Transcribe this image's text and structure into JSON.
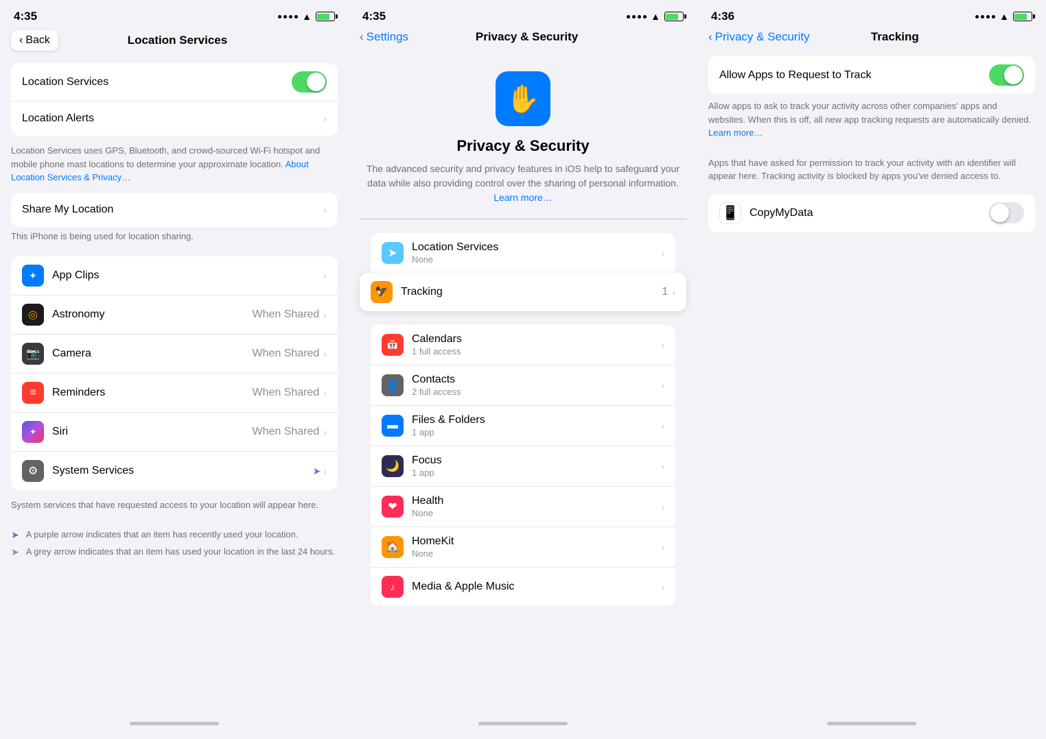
{
  "panel1": {
    "time": "4:35",
    "title": "Location Services",
    "back_label": "Back",
    "items": [
      {
        "id": "location-services",
        "label": "Location Services",
        "toggle": "on",
        "icon_color": "green",
        "icon": "📍"
      },
      {
        "id": "location-alerts",
        "label": "Location Alerts",
        "chevron": true,
        "icon_color": "none",
        "icon": ""
      }
    ],
    "info_text": "Location Services uses GPS, Bluetooth, and crowd-sourced Wi-Fi hotspot and mobile phone mast locations to determine your approximate location.",
    "info_link": "About Location Services & Privacy…",
    "share_my_location_label": "Share My Location",
    "share_my_location_subtitle": "This iPhone is being used for location sharing.",
    "app_list": [
      {
        "label": "App Clips",
        "icon": "🔵",
        "icon_color": "blue",
        "value": "",
        "chevron": true
      },
      {
        "label": "Astronomy",
        "icon": "⭕",
        "icon_color": "dark",
        "value": "When Shared",
        "chevron": true
      },
      {
        "label": "Camera",
        "icon": "📷",
        "icon_color": "gray",
        "value": "When Shared",
        "chevron": true
      },
      {
        "label": "Reminders",
        "icon": "📋",
        "icon_color": "red",
        "value": "When Shared",
        "chevron": true
      },
      {
        "label": "Siri",
        "icon": "🎨",
        "icon_color": "purple",
        "value": "When Shared",
        "chevron": true
      },
      {
        "label": "System Services",
        "icon": "⚙️",
        "icon_color": "gray",
        "value": "",
        "chevron": true,
        "arrow_purple": true
      }
    ],
    "legend_purple": "A purple arrow indicates that an item has recently used your location.",
    "legend_gray": "A grey arrow indicates that an item has used your location in the last 24 hours."
  },
  "panel2": {
    "time": "4:35",
    "back_label": "Settings",
    "title": "Privacy & Security",
    "hero_icon": "✋",
    "hero_title": "Privacy & Security",
    "hero_desc": "The advanced security and privacy features in iOS help to safeguard your data while also providing control over the sharing of personal information.",
    "hero_link": "Learn more…",
    "menu_items": [
      {
        "id": "location-services",
        "label": "Location Services",
        "subtitle": "None",
        "icon": "✈️",
        "icon_color": "teal",
        "chevron": true,
        "badge": ""
      },
      {
        "id": "tracking",
        "label": "Tracking",
        "subtitle": "",
        "icon": "🦅",
        "icon_color": "orange",
        "chevron": true,
        "badge": "1",
        "highlighted": true
      },
      {
        "id": "calendars",
        "label": "Calendars",
        "subtitle": "1 full access",
        "icon": "📅",
        "icon_color": "red",
        "chevron": true
      },
      {
        "id": "contacts",
        "label": "Contacts",
        "subtitle": "2 full access",
        "icon": "👥",
        "icon_color": "gray",
        "chevron": true
      },
      {
        "id": "files-folders",
        "label": "Files & Folders",
        "subtitle": "1 app",
        "icon": "📁",
        "icon_color": "blue",
        "chevron": true
      },
      {
        "id": "focus",
        "label": "Focus",
        "subtitle": "1 app",
        "icon": "🌙",
        "icon_color": "navy",
        "chevron": true
      },
      {
        "id": "health",
        "label": "Health",
        "subtitle": "None",
        "icon": "❤️",
        "icon_color": "pink",
        "chevron": true
      },
      {
        "id": "homekit",
        "label": "HomeKit",
        "subtitle": "None",
        "icon": "🏠",
        "icon_color": "orange",
        "chevron": true
      },
      {
        "id": "media-apple-music",
        "label": "Media & Apple Music",
        "subtitle": "",
        "icon": "🎵",
        "icon_color": "pink",
        "chevron": true
      }
    ]
  },
  "panel3": {
    "time": "4:36",
    "back_label": "Privacy & Security",
    "title": "Tracking",
    "toggle_label": "Allow Apps to Request to Track",
    "toggle_state": "on",
    "desc1": "Allow apps to ask to track your activity across other companies' apps and websites. When this is off, all new app tracking requests are automatically denied.",
    "desc1_link": "Learn more…",
    "desc2": "Apps that have asked for permission to track your activity with an identifier will appear here. Tracking activity is blocked by apps you've denied access to.",
    "app_item": {
      "label": "CopyMyData",
      "toggle": "off"
    }
  }
}
